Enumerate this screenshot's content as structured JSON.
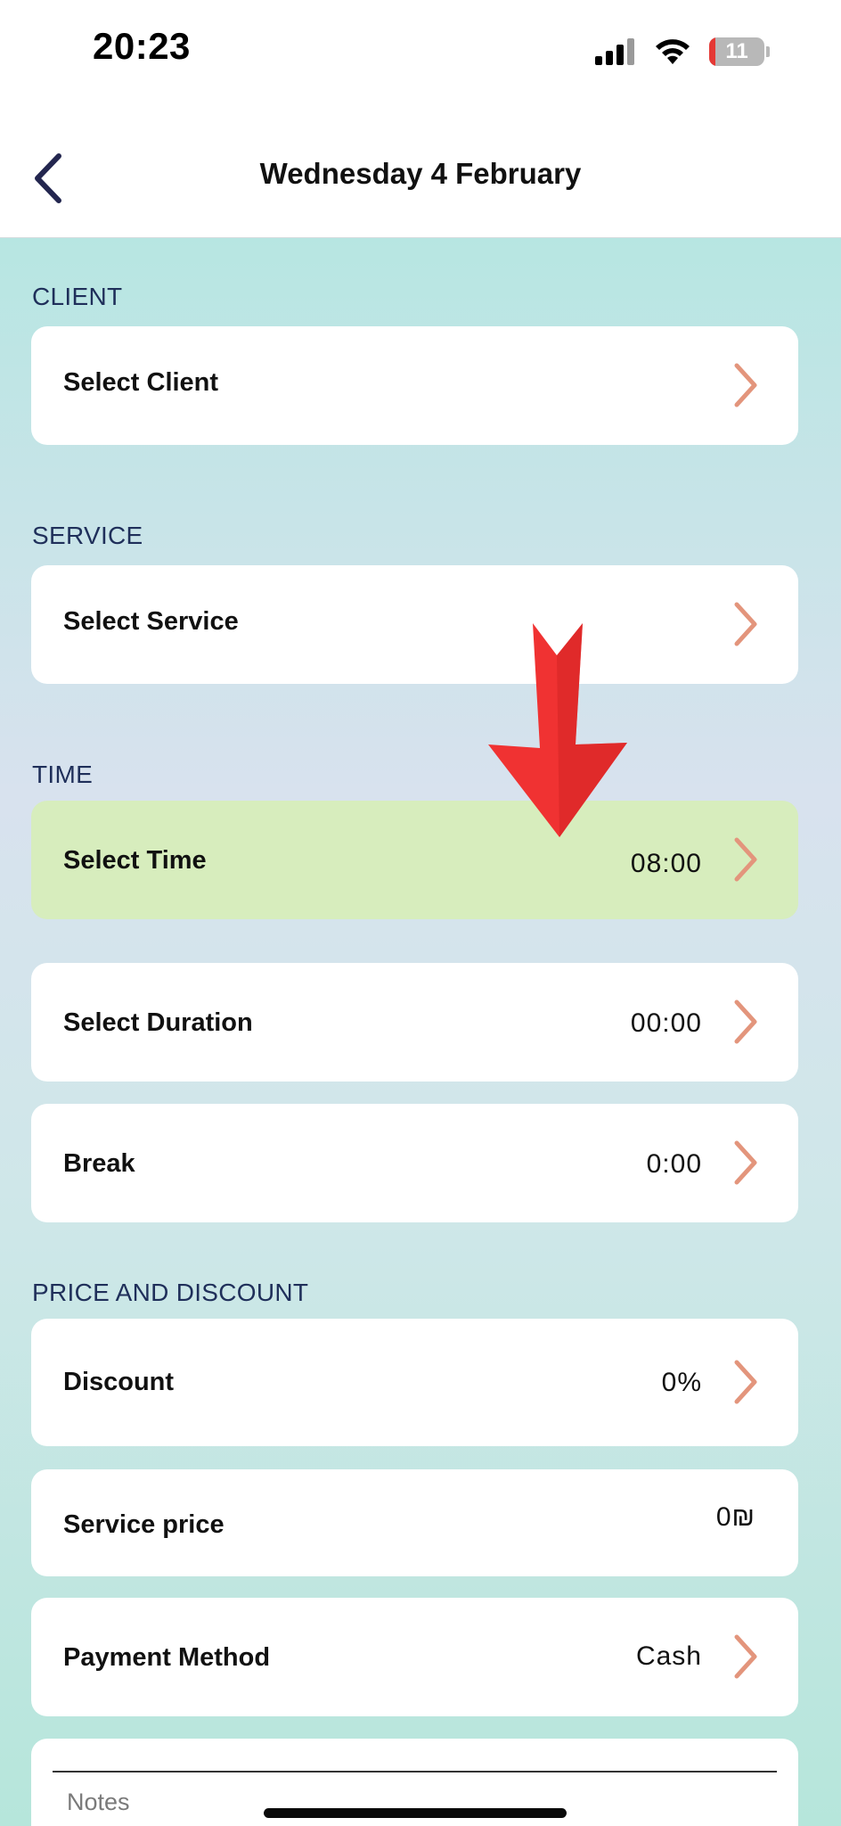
{
  "status_bar": {
    "time": "20:23",
    "battery_level": "11",
    "icons": [
      "signal-icon",
      "wifi-icon",
      "battery-icon"
    ]
  },
  "header": {
    "title": "Wednesday 4 February",
    "back_icon": "chevron-left-icon"
  },
  "sections": {
    "client": {
      "label": "CLIENT",
      "row": {
        "label": "Select Client",
        "value": ""
      }
    },
    "service": {
      "label": "SERVICE",
      "row": {
        "label": "Select Service",
        "value": ""
      }
    },
    "time": {
      "label": "TIME",
      "select_time": {
        "label": "Select Time",
        "value": "08:00"
      },
      "select_duration": {
        "label": "Select Duration",
        "value": "00:00"
      },
      "break": {
        "label": "Break",
        "value": "0:00"
      }
    },
    "price": {
      "label": "PRICE AND DISCOUNT",
      "discount": {
        "label": "Discount",
        "value": "0%"
      },
      "service_price": {
        "label": "Service price",
        "value": "0₪"
      },
      "payment_method": {
        "label": "Payment Method",
        "value": "Cash"
      }
    },
    "notes": {
      "placeholder": "Notes"
    }
  },
  "colors": {
    "accent_chevron": "#e3957c",
    "section_label": "#1f2f5a",
    "highlight_row": "#d7edbd",
    "annotation_arrow": "#f03232"
  }
}
